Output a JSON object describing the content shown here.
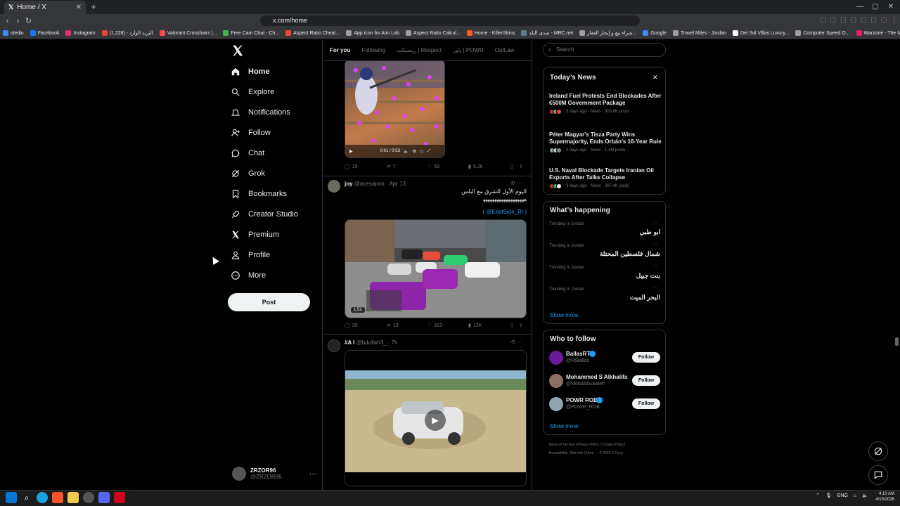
{
  "browser": {
    "tab_title": "Home / X",
    "url": "x.com/home",
    "bookmarks": [
      {
        "label": "stedio",
        "color": "#4285f4"
      },
      {
        "label": "Facebook",
        "color": "#1877f2"
      },
      {
        "label": "Instagram",
        "color": "#e1306c"
      },
      {
        "label": "البريد الوارد - (1,228)",
        "color": "#ea4335"
      },
      {
        "label": "Valorant Crosshairs |...",
        "color": "#ff4655"
      },
      {
        "label": "Free Cam Chat - Ch...",
        "color": "#4caf50"
      },
      {
        "label": "Aspect Ratio Cheat...",
        "color": "#f44336"
      },
      {
        "label": "App icon for Aim Lab",
        "color": "#9e9e9e"
      },
      {
        "label": "Aspect Ratio Calcul...",
        "color": "#9e9e9e"
      },
      {
        "label": "Home - KillerSkins",
        "color": "#ff5722"
      },
      {
        "label": "صدى البلد - MBC.net",
        "color": "#607d8b"
      },
      {
        "label": "شراء بيع و إيجار العقار...",
        "color": "#9e9e9e"
      },
      {
        "label": "Google",
        "color": "#4285f4"
      },
      {
        "label": "Travel Miles - Jordan",
        "color": "#9e9e9e"
      },
      {
        "label": "Del Sol Villas Luxury...",
        "color": "#ffffff"
      },
      {
        "label": "Computer Speed O...",
        "color": "#9e9e9e"
      },
      {
        "label": "Warzone - The Most...",
        "color": "#e91e63"
      }
    ]
  },
  "nav": {
    "items": [
      {
        "label": "Home",
        "icon": "home-icon"
      },
      {
        "label": "Explore",
        "icon": "search-icon"
      },
      {
        "label": "Notifications",
        "icon": "bell-icon"
      },
      {
        "label": "Follow",
        "icon": "person-add-icon"
      },
      {
        "label": "Chat",
        "icon": "chat-icon"
      },
      {
        "label": "Grok",
        "icon": "grok-icon"
      },
      {
        "label": "Bookmarks",
        "icon": "bookmark-icon"
      },
      {
        "label": "Creator Studio",
        "icon": "rocket-icon"
      },
      {
        "label": "Premium",
        "icon": "x-icon"
      },
      {
        "label": "Profile",
        "icon": "person-icon"
      },
      {
        "label": "More",
        "icon": "more-circle-icon"
      }
    ],
    "post_label": "Post",
    "account": {
      "name": "ZRZOR96",
      "handle": "@ZRZOR96"
    }
  },
  "feed": {
    "tabs": [
      "For you",
      "Following",
      "ريسبكت | Respect",
      "باور | POWR",
      "OutLaw"
    ],
    "tweet1": {
      "time": "0:01 / 0:53",
      "replies": "15",
      "reposts": "7",
      "likes": "59",
      "views": "9.2K"
    },
    "tweet2": {
      "name": "joy",
      "handle": "@acesapoo",
      "date": "Apr 13",
      "text1": "اليوم الأول للشرق مع البلس",
      "text2": "ﻫﻬﻬﻬﻬﻬﻬﻬﻬﻬﻬﻬﻬﻬﻬﻬﻬﻬﻬ",
      "mention": "( @EastSide_Rt )",
      "duration": "1:52",
      "replies": "20",
      "reposts": "19",
      "likes": "313",
      "views": "13K"
    },
    "tweet3": {
      "name": "#A I",
      "handle": "@bdullah3_",
      "date": "7h"
    }
  },
  "right": {
    "search_placeholder": "Search",
    "news_title": "Today’s News",
    "news": [
      {
        "headline": "Ireland Fuel Protests End Blockades After €500M Government Package",
        "meta": "3 days ago · News · 300.8K posts"
      },
      {
        "headline": "Péter Magyar's Tisza Party Wins Supermajority, Ends Orbán's 16-Year Rule",
        "meta": "3 days ago · News · 1.4M posts"
      },
      {
        "headline": "U.S. Naval Blockade Targets Iranian Oil Exports After Talks Collapse",
        "meta": "3 days ago · News · 387.4K posts"
      }
    ],
    "happening_title": "What’s happening",
    "trends": [
      {
        "label": "Trending in Jordan",
        "name": "ابو طبي"
      },
      {
        "label": "Trending in Jordan",
        "name": "شمال فلسطين المحتلة"
      },
      {
        "label": "Trending in Jordan",
        "name": "بنت جبيل"
      },
      {
        "label": "Trending in Jordan",
        "name": "البحر الميت"
      }
    ],
    "show_more": "Show more",
    "who_title": "Who to follow",
    "who": [
      {
        "name": "BallasRT",
        "handle": "@RtBallas",
        "button": "Follow"
      },
      {
        "name": "Mohammed S Alkhalifa",
        "handle": "@MohdAbuSaleh",
        "button": "Follow"
      },
      {
        "name": "POWR ROB 7",
        "handle": "@POWR_ROB",
        "button": "Follow"
      }
    ],
    "footer1": "Terms of Service  |  Privacy Policy  |  Cookie Policy  |",
    "footer2": "Accessibility  |  Ads info  |  More ···  © 2026 X Corp."
  },
  "taskbar": {
    "lang": "ENG",
    "time": "4:10 AM",
    "date": "4/15/2026"
  },
  "colors": {
    "accent": "#1d9bf0",
    "border": "#2f3336",
    "muted": "#71767b"
  }
}
